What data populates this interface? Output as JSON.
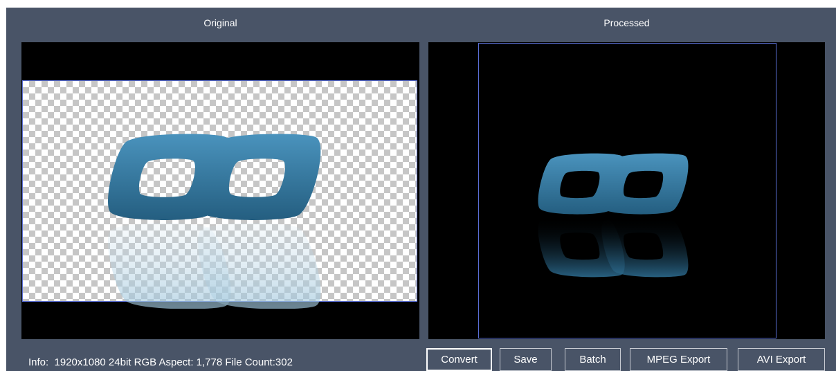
{
  "panels": {
    "original_title": "Original",
    "processed_title": "Processed"
  },
  "images": {
    "original_logo": "infinity-logo-transparent",
    "processed_logo": "infinity-logo-reflection"
  },
  "info": {
    "text": "Info:  1920x1080 24bit RGB Aspect: 1,778 File Count:302"
  },
  "toolbar": {
    "convert_label": "Convert",
    "save_label": "Save",
    "batch_label": "Batch",
    "mpeg_export_label": "MPEG Export",
    "avi_export_label": "AVI Export"
  },
  "colors": {
    "background": "#495467",
    "viewport": "#000000",
    "selection_frame": "#5a6fd6",
    "logo": "#3a7fa6"
  }
}
